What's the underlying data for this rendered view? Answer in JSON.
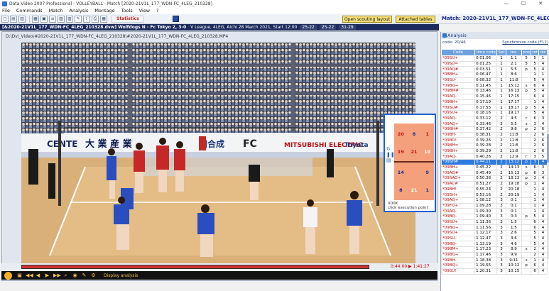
{
  "window": {
    "title": "Data Video 2007 Professional - VOLLEYBALL - Match [2020-21V1L_177_WDN-FC_4LEG_210328]",
    "controls": [
      "—",
      "☐",
      "✕"
    ]
  },
  "menu": [
    "File",
    "Commands",
    "Match",
    "Analysis",
    "Montage",
    "Tools",
    "View",
    "?"
  ],
  "toolbar": {
    "statistics_label": "Statistics",
    "open_scouting_label": "Open scouting layout",
    "attached_tables_label": "Attached tables",
    "match_title": "Match: 2020-21V1L_177_WDN-FC_4LEG_210328"
  },
  "header": {
    "file": "[&2020-21V1L_177_WDN-FC_4LEG_210328.dvw] Wolfdogs N - Fc Tokyo 2, 3-0",
    "meta": "V League, 4LEG, Aichi 28 March 2021, Start 12:00",
    "scores": [
      "25-22",
      "25-22",
      "31-29"
    ]
  },
  "video": {
    "path": "D:\\Dvi_Video\\#2020-21V1L_177_WDN-FC_4LEG_210328\\#2020-21V1L_177_WDN-FC_4LEG_210328.MP4",
    "time": "0:44:00 ▶ 1:41:27",
    "display_analysis_label": "Display analysis",
    "banners": [
      "CENTE",
      "大 業 産 業",
      "田合成",
      "FC",
      "MITSUBISHI ELECTRIC",
      "Toyota"
    ]
  },
  "court": {
    "top_row1": [
      "20",
      "8",
      "1"
    ],
    "top_row2": [
      "19",
      "21",
      "10"
    ],
    "bottom_row1": [
      "14",
      "",
      "9"
    ],
    "bottom_row2": [
      "8",
      "21",
      "1"
    ],
    "label_top": "X00K",
    "label_bottom": "click execution point"
  },
  "analysis": {
    "title": "Analysis",
    "code_count": "code: 20/46",
    "sync_label": "Synchronize code (F12)",
    "columns": [
      "Code",
      "time code",
      "Set",
      "res.",
      "pos",
      "rot",
      "rec"
    ],
    "rows": [
      [
        "*09SU+",
        "0.01.06",
        "1",
        "1:1",
        "5",
        "5",
        "1"
      ],
      [
        "*09SU=",
        "0.01.25",
        "1",
        "2:1",
        "5",
        "5",
        "4"
      ],
      [
        "*09AQ#",
        "0.03.51",
        "1",
        "5:5",
        "p",
        "5",
        "4"
      ],
      [
        "*08BH+",
        "0.06.47",
        "1",
        "8:6",
        "",
        "1",
        "1"
      ],
      [
        "*09SU-",
        "0.08.32",
        "1",
        "11:8",
        "",
        "5",
        "4"
      ],
      [
        "*09BQ+",
        "0.11.45",
        "1",
        "15:12",
        "s",
        "6",
        "4"
      ],
      [
        "*09BM#",
        "0.13.46",
        "1",
        "16:13",
        "p",
        "5",
        "4"
      ],
      [
        "*09AQ-",
        "0.15.46",
        "1",
        "17:15",
        "",
        "6",
        "4"
      ],
      [
        "*09BH+",
        "0.17.19",
        "1",
        "17:17",
        "",
        "1",
        "4"
      ],
      [
        "*09SU#",
        "0.17.55",
        "1",
        "18:17",
        "p",
        "5",
        "4"
      ],
      [
        "*09SU+",
        "0.18.16",
        "1",
        "19:17",
        "",
        "5",
        "4"
      ],
      [
        "*09AQ-",
        "0.33.12",
        "2",
        "4:5",
        "r",
        "6",
        "3"
      ],
      [
        "*09AQ+",
        "0.33.46",
        "2",
        "5:5",
        "s",
        "3",
        "4"
      ],
      [
        "*09BH#",
        "0.37.42",
        "2",
        "9:8",
        "p",
        "2",
        "6"
      ],
      [
        "*09BH-",
        "0.38.31",
        "2",
        "11:8",
        "",
        "2",
        "6"
      ],
      [
        "*09BO!",
        "0.39.26",
        "2",
        "11:8",
        "",
        "2",
        "6"
      ],
      [
        "*09BH=",
        "0.39.28",
        "2",
        "11:8",
        "",
        "2",
        "6"
      ],
      [
        "*09BH+",
        "0.39.29",
        "2",
        "11:8",
        "",
        "2",
        "6"
      ],
      [
        "*09AQ-",
        "0.40.26",
        "2",
        "12:9",
        "r",
        "3",
        "5"
      ],
      [
        "*09SH#",
        "0.44.11",
        "2",
        "13:12",
        "p",
        "3",
        "4"
      ],
      [
        "*09BH+",
        "0.45.22",
        "2",
        "14:13",
        "s",
        "6",
        "3"
      ],
      [
        "*09AQ#",
        "0.45.49",
        "2",
        "15:13",
        "p",
        "6",
        "3"
      ],
      [
        "*09SAQ+",
        "0.50.38",
        "2",
        "18:13",
        "p",
        "3",
        "4"
      ],
      [
        "*09AC#",
        "0.51.27",
        "2",
        "19:18",
        "p",
        "1",
        "4"
      ],
      [
        "*09BH!",
        "0.55.24",
        "2",
        "20:18",
        "",
        "1",
        "4"
      ],
      [
        "*09SH+",
        "0.53.16",
        "2",
        "20:19",
        "",
        "1",
        "4"
      ],
      [
        "*09AQ+",
        "1.08.12",
        "3",
        "0:1",
        "",
        "1",
        "4"
      ],
      [
        "*09FQ+",
        "1.09.28",
        "3",
        "0:1",
        "",
        "1",
        "4"
      ],
      [
        "*09AQ-",
        "1.09.30",
        "3",
        "0:1",
        "",
        "1",
        "4"
      ],
      [
        "*09BQ-",
        "1.09.40",
        "3",
        "0:3",
        "p",
        "5",
        "4"
      ],
      [
        "*09SU+",
        "1.11.36",
        "3",
        "1:5",
        "",
        "6",
        "4"
      ],
      [
        "*09BQ+",
        "1.11.56",
        "3",
        "1:5",
        "",
        "6",
        "4"
      ],
      [
        "*09SU+",
        "1.12.17",
        "3",
        "2:6",
        "",
        "5",
        "4"
      ],
      [
        "*09SU-",
        "1.12.47",
        "3",
        "3:6",
        "",
        "5",
        "4"
      ],
      [
        "*09BQ-",
        "1.13.19",
        "3",
        "4:6",
        "",
        "5",
        "4"
      ],
      [
        "*09BM+",
        "1.17.23",
        "3",
        "8:9",
        "s",
        "2",
        "4"
      ],
      [
        "*09BQ+",
        "1.17.46",
        "3",
        "9:9",
        "",
        "2",
        "4"
      ],
      [
        "*09BH-",
        "1.18.38",
        "3",
        "9:11",
        "s",
        "1",
        "4"
      ],
      [
        "*09BQ+",
        "1.19.55",
        "3",
        "10:12",
        "p",
        "6",
        "4"
      ],
      [
        "*09SU!",
        "1.20.31",
        "3",
        "10:15",
        "",
        "6",
        "4"
      ]
    ],
    "selected_index": 19
  }
}
